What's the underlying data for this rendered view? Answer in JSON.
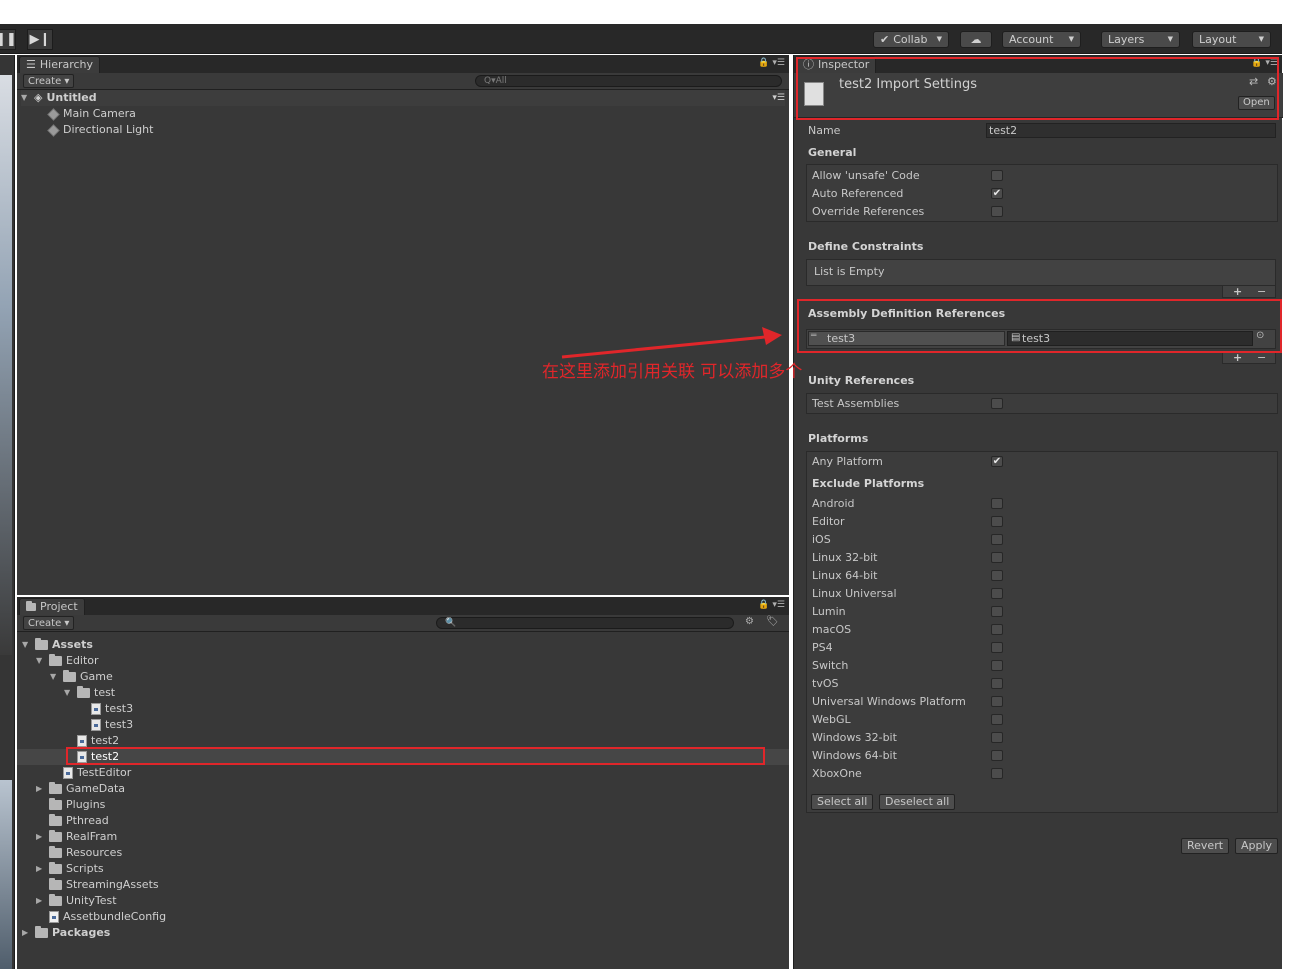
{
  "toolbar": {
    "collab": "Collab",
    "account": "Account",
    "layers": "Layers",
    "layout": "Layout"
  },
  "hierarchy": {
    "tab_label": "Hierarchy",
    "create": "Create",
    "search_placeholder": "All",
    "scene_name": "Untitled",
    "items": [
      "Main Camera",
      "Directional Light"
    ]
  },
  "project": {
    "tab_label": "Project",
    "create": "Create",
    "tree": {
      "assets": "Assets",
      "editor": "Editor",
      "game": "Game",
      "test": "test",
      "test3a": "test3",
      "test3b": "test3",
      "test2a": "test2",
      "test2b": "test2",
      "testeditor": "TestEditor",
      "gamedata": "GameData",
      "plugins": "Plugins",
      "pthread": "Pthread",
      "realfram": "RealFram",
      "resources": "Resources",
      "scripts": "Scripts",
      "streamingassets": "StreamingAssets",
      "unitytest": "UnityTest",
      "assetbundleconfig": "AssetbundleConfig",
      "packages": "Packages"
    }
  },
  "inspector": {
    "tab_label": "Inspector",
    "title": "test2 Import Settings",
    "open": "Open",
    "name_label": "Name",
    "name_value": "test2",
    "general": "General",
    "allow_unsafe": "Allow 'unsafe' Code",
    "auto_referenced": "Auto Referenced",
    "override_refs": "Override References",
    "define_constraints": "Define Constraints",
    "list_empty": "List is Empty",
    "asm_refs": "Assembly Definition References",
    "ref_name": "test3",
    "ref_obj": "test3",
    "unity_refs": "Unity References",
    "test_assemblies": "Test Assemblies",
    "platforms": "Platforms",
    "any_platform": "Any Platform",
    "exclude_platforms": "Exclude Platforms",
    "platform_list": [
      "Android",
      "Editor",
      "iOS",
      "Linux 32-bit",
      "Linux 64-bit",
      "Linux Universal",
      "Lumin",
      "macOS",
      "PS4",
      "Switch",
      "tvOS",
      "Universal Windows Platform",
      "WebGL",
      "Windows 32-bit",
      "Windows 64-bit",
      "XboxOne"
    ],
    "select_all": "Select all",
    "deselect_all": "Deselect all",
    "revert": "Revert",
    "apply": "Apply"
  },
  "annotation": {
    "text": "在这里添加引用关联 可以添加多个"
  },
  "colors": {
    "panel": "#383838",
    "highlight_red": "#e0262a"
  }
}
